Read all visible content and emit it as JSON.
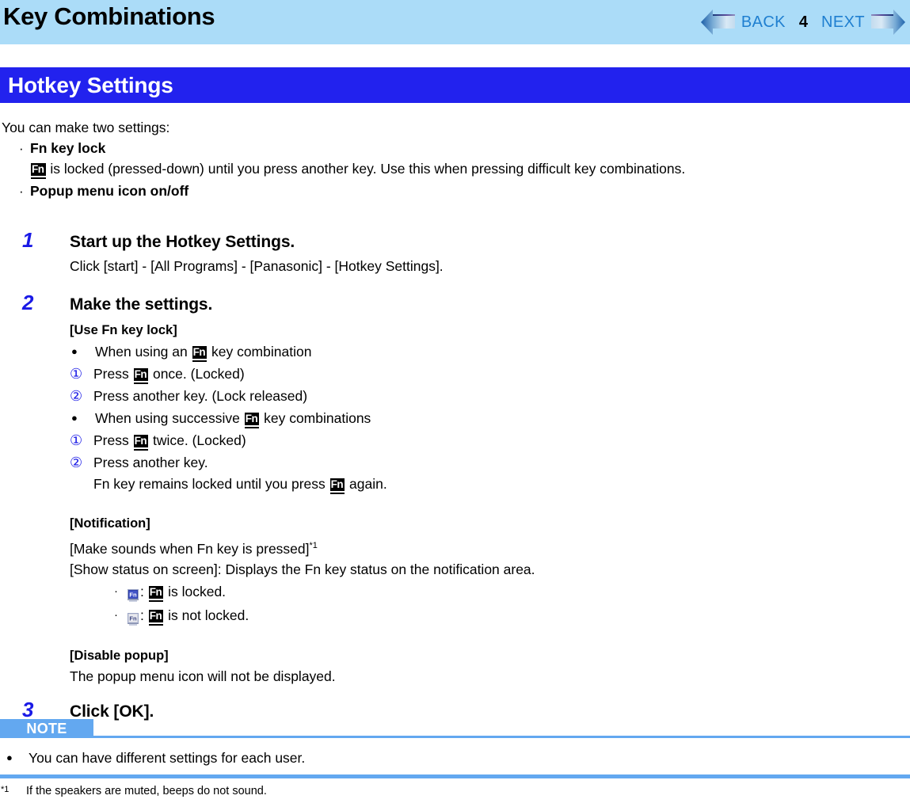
{
  "header": {
    "title": "Key Combinations",
    "nav": {
      "back_label": "BACK",
      "page_number": "4",
      "next_label": "NEXT",
      "back_icon": "arrow-left-icon",
      "next_icon": "arrow-right-icon"
    },
    "band_color": "#ABDCF8"
  },
  "section": {
    "title": "Hotkey Settings",
    "bar_color": "#2222EE",
    "title_color": "#FFFFFF"
  },
  "intro": {
    "lead": "You can make two settings:",
    "bullets": [
      {
        "marker": "·",
        "label": "Fn key lock"
      },
      {
        "marker": "·",
        "label": "Popup menu icon on/off"
      }
    ],
    "fn_lock_detail_before": "",
    "fn_lock_detail_after": " is locked (pressed-down) until you press another key. Use this when pressing difficult key combinations."
  },
  "steps": [
    {
      "number": "1",
      "heading": "Start up the Hotkey Settings.",
      "body": "Click [start] - [All Programs] - [Panasonic] - [Hotkey Settings]."
    },
    {
      "number": "2",
      "heading": "Make the settings.",
      "use_fn_heading": "[Use Fn key lock]",
      "rows": [
        {
          "marker": "●",
          "marker_kind": "dot",
          "before": "When using an ",
          "after": " key combination"
        },
        {
          "marker": "①",
          "marker_kind": "circled",
          "before": "Press ",
          "after": " once. (Locked)"
        },
        {
          "marker": "②",
          "marker_kind": "circled",
          "before": "Press another key. (Lock released)",
          "after": "",
          "no_fn": true
        },
        {
          "marker": "●",
          "marker_kind": "dot",
          "before": "When using successive ",
          "after": " key combinations"
        },
        {
          "marker": "①",
          "marker_kind": "circled",
          "before": "Press ",
          "after": " twice. (Locked)"
        },
        {
          "marker": "②",
          "marker_kind": "circled",
          "before": "Press another key.",
          "after": "",
          "no_fn": true
        }
      ],
      "continuation_before": "Fn key remains locked until you press ",
      "continuation_after": " again.",
      "notification_heading": "[Notification]",
      "notification_line1": "[Make sounds when Fn key is pressed]",
      "notification_line1_ref": "*1",
      "notification_line2": "[Show status on screen]: Displays the Fn key status on the notification area.",
      "notification_items": [
        {
          "bullet": "·",
          "icon": "fn-locked-tray-icon",
          "sep": ": ",
          "after": " is locked."
        },
        {
          "bullet": "·",
          "icon": "fn-unlocked-tray-icon",
          "sep": ": ",
          "after": " is not locked."
        }
      ],
      "disable_popup_heading": "[Disable popup]",
      "disable_popup_body": "The popup menu icon will not be displayed."
    },
    {
      "number": "3",
      "heading": "Click [OK].",
      "body": ""
    }
  ],
  "note": {
    "label": "NOTE",
    "bullet": "●",
    "text": "You can have different settings for each user.",
    "accent_color": "#63A8F0"
  },
  "footnote": {
    "mark": "*1",
    "text": "If the speakers are muted, beeps do not sound."
  },
  "fn_key_glyph": "Fn"
}
